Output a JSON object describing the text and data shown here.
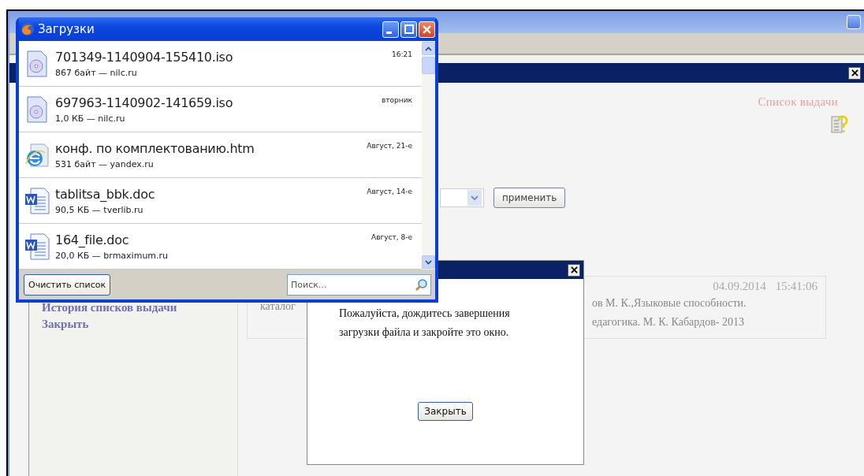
{
  "downloads_window": {
    "title": "Загрузки",
    "items": [
      {
        "kind": "disc",
        "name": "701349-1140904-155410.iso",
        "details": "867 байт — nilc.ru",
        "time": "16:21"
      },
      {
        "kind": "disc",
        "name": "697963-1140902-141659.iso",
        "details": "1,0 КБ — nilc.ru",
        "time": "вторник"
      },
      {
        "kind": "web",
        "name": "конф. по комплектованию.htm",
        "details": "531 байт — yandex.ru",
        "time": "Август, 21-е"
      },
      {
        "kind": "word",
        "name": "tablitsa_bbk.doc",
        "details": "90,5 КБ — tverlib.ru",
        "time": "Август, 14-е"
      },
      {
        "kind": "word",
        "name": "164_file.doc",
        "details": "20,0 КБ — brmaximum.ru",
        "time": "Август, 8-е"
      }
    ],
    "clear_button": "Очистить список",
    "search": {
      "placeholder": "Поиск..."
    }
  },
  "page": {
    "heading": "Список выдачи",
    "apply_button": "применить",
    "sidebar_links": [
      "История списков выдачи",
      "Закрыть"
    ],
    "record": {
      "column_1": "каталог",
      "date": "04.09.2014",
      "time": "15:41:06",
      "lines": [
        "ов М. К.,Языковые способности.",
        "едагогика. М. К. Кабардов- 2013"
      ]
    }
  },
  "dialog": {
    "message": "Пожалуйста, дождитесь завершения загрузки файла и закройте это окно.",
    "button": "Закрыть"
  }
}
